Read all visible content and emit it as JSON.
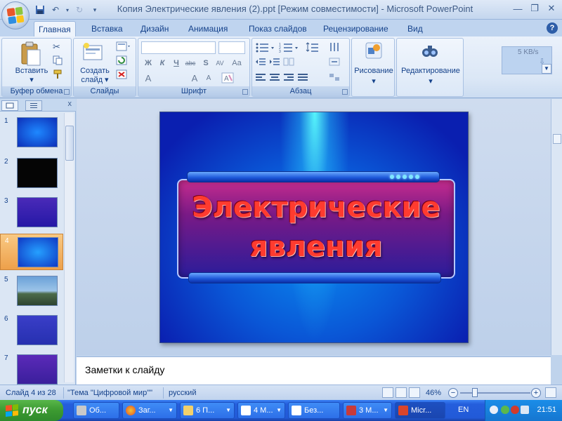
{
  "window": {
    "title": "Копия Электрические явления (2).ppt [Режим совместимости] - Microsoft PowerPoint"
  },
  "tabs": [
    "Главная",
    "Вставка",
    "Дизайн",
    "Анимация",
    "Показ слайдов",
    "Рецензирование",
    "Вид"
  ],
  "ribbon": {
    "paste_label": "Вставить",
    "paste_arrow": "▾",
    "clipboard_group": "Буфер обмена",
    "new_slide_label_1": "Создать",
    "new_slide_label_2": "слайд ▾",
    "slides_group": "Слайды",
    "font_group": "Шрифт",
    "font_bold": "Ж",
    "font_italic": "К",
    "font_underline": "Ч",
    "font_strike": "abc",
    "font_shadow": "S",
    "font_spacing": "AV",
    "font_aa": "Aa",
    "font_grow": "A",
    "font_shrink": "A",
    "paragraph_group": "Абзац",
    "drawing_label": "Рисование",
    "editing_label": "Редактирование",
    "dropdown_arrow": "▾",
    "network_speed": "5 KB/s"
  },
  "slides_pane": {
    "close_icon": "x",
    "items": [
      {
        "num": "1",
        "selected": false,
        "style": "blue-title"
      },
      {
        "num": "2",
        "selected": false,
        "style": "black"
      },
      {
        "num": "3",
        "selected": false,
        "style": "purple-text"
      },
      {
        "num": "4",
        "selected": true,
        "style": "current"
      },
      {
        "num": "5",
        "selected": false,
        "style": "photo"
      },
      {
        "num": "6",
        "selected": false,
        "style": "blue-text"
      },
      {
        "num": "7",
        "selected": false,
        "style": "purple-title"
      }
    ]
  },
  "slide": {
    "title_line1": "Электрические",
    "title_line2": "явления"
  },
  "notes": {
    "placeholder": "Заметки к слайду"
  },
  "statusbar": {
    "slide_info": "Слайд 4 из 28",
    "theme": "\"Тема \"Цифровой мир\"\"",
    "language": "русский",
    "zoom": "46%",
    "zoom_minus": "−",
    "zoom_plus": "+"
  },
  "taskbar": {
    "start": "пуск",
    "tasks": [
      {
        "label": "Об...",
        "active": false
      },
      {
        "label": "Заг...",
        "active": false
      },
      {
        "label": "6 П...",
        "active": false
      },
      {
        "label": "4 М...",
        "active": false
      },
      {
        "label": "Без...",
        "active": false
      },
      {
        "label": "3 М...",
        "active": false
      },
      {
        "label": "Micr...",
        "active": true
      }
    ],
    "lang": "EN",
    "clock": "21:51"
  },
  "colors": {
    "accent": "#15428b",
    "slide_title": "#ff3b2f",
    "selection": "#eda04a"
  }
}
